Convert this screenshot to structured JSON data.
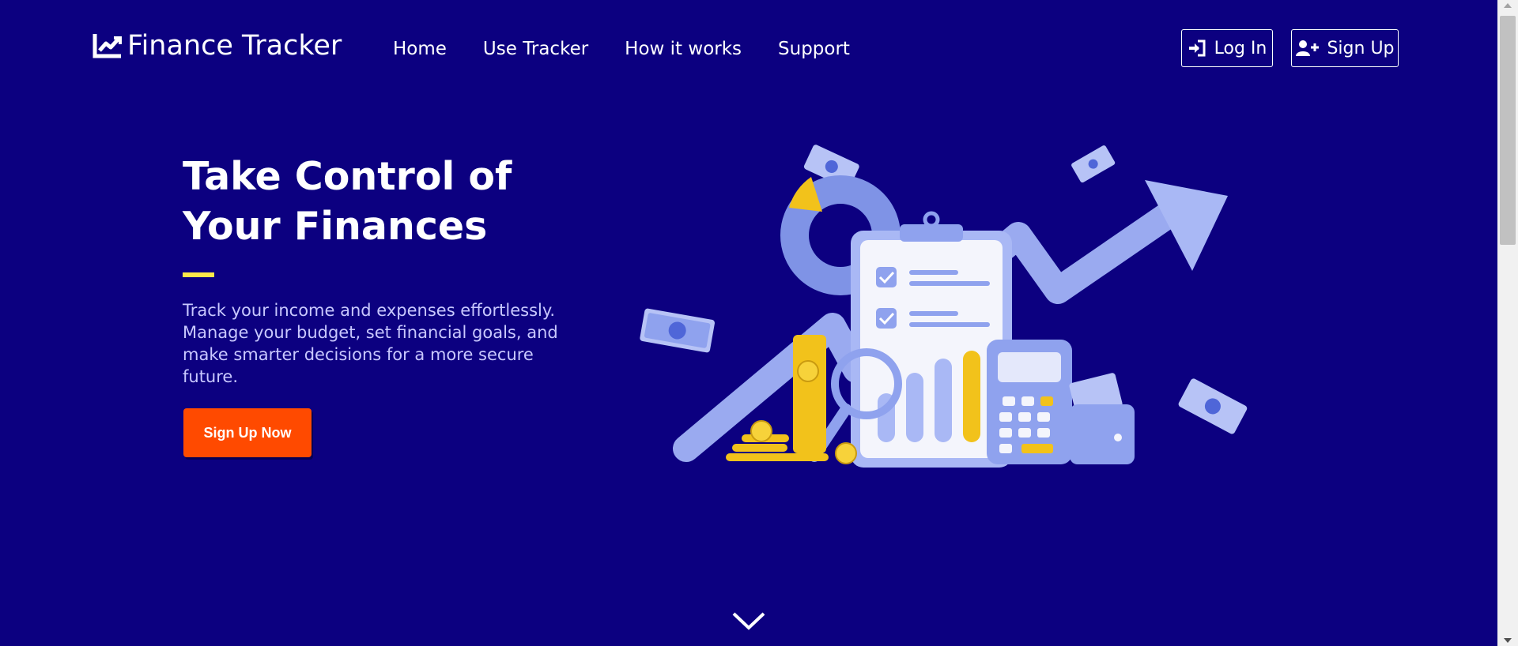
{
  "navbar": {
    "brand": "Finance Tracker",
    "brand_icon": "chart-line-icon",
    "links": [
      "Home",
      "Use Tracker",
      "How it works",
      "Support"
    ],
    "login_label": "Log In",
    "login_icon": "sign-in-icon",
    "signup_label": "Sign Up",
    "signup_icon": "user-plus-icon"
  },
  "hero": {
    "title_line1": "Take Control of",
    "title_line2": "Your Finances",
    "description": "Track your income and expenses effortlessly. Manage your budget, set financial goals, and make smarter decisions for a more secure future.",
    "cta_label": "Sign Up Now",
    "illustration": "finance-illustration"
  },
  "scroll_hint_icon": "chevron-down-icon",
  "colors": {
    "background": "#0c0080",
    "accent_bar": "#ffe94a",
    "cta": "#ff4a00",
    "description_text": "#c9c8ff",
    "illustration_blue": "#a9b8f5",
    "coin_yellow": "#f2c21b"
  }
}
